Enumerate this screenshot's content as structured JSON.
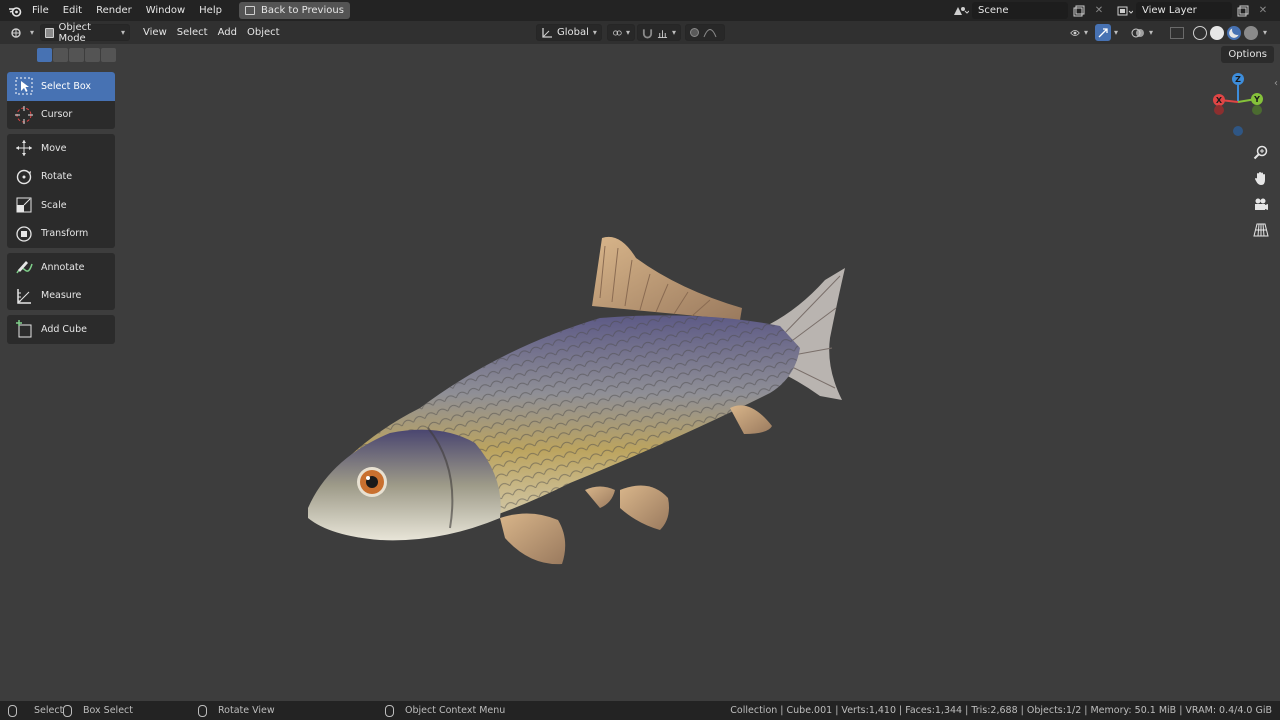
{
  "topbar": {
    "menus": [
      "File",
      "Edit",
      "Render",
      "Window",
      "Help"
    ],
    "back_label": "Back to Previous",
    "scene_value": "Scene",
    "view_layer_value": "View Layer"
  },
  "header": {
    "mode_label": "Object Mode",
    "view_menu": "View",
    "select_menu": "Select",
    "add_menu": "Add",
    "object_menu": "Object",
    "transform_orientation": "Global",
    "options_label": "Options"
  },
  "toolbar": {
    "tools": [
      {
        "label": "Select Box",
        "icon": "select-box-icon",
        "active": true
      },
      {
        "label": "Cursor",
        "icon": "cursor-icon"
      },
      {
        "label": "Move",
        "icon": "move-icon"
      },
      {
        "label": "Rotate",
        "icon": "rotate-icon"
      },
      {
        "label": "Scale",
        "icon": "scale-icon"
      },
      {
        "label": "Transform",
        "icon": "transform-icon"
      },
      {
        "label": "Annotate",
        "icon": "annotate-icon"
      },
      {
        "label": "Measure",
        "icon": "measure-icon"
      },
      {
        "label": "Add Cube",
        "icon": "add-cube-icon"
      }
    ]
  },
  "gizmo": {
    "z_label": "Z",
    "y_label": "Y",
    "x_label": "X"
  },
  "status": {
    "select": "Select",
    "box_select": "Box Select",
    "rotate_view": "Rotate View",
    "context_menu": "Object Context Menu",
    "stats": "Collection | Cube.001 | Verts:1,410 | Faces:1,344 | Tris:2,688 | Objects:1/2 | Memory: 50.1 MiB | VRAM: 0.4/4.0 GiB"
  },
  "colors": {
    "accent": "#4772b3",
    "axis_x": "#e04545",
    "axis_y": "#85c23a",
    "axis_z": "#3d8ddb"
  }
}
